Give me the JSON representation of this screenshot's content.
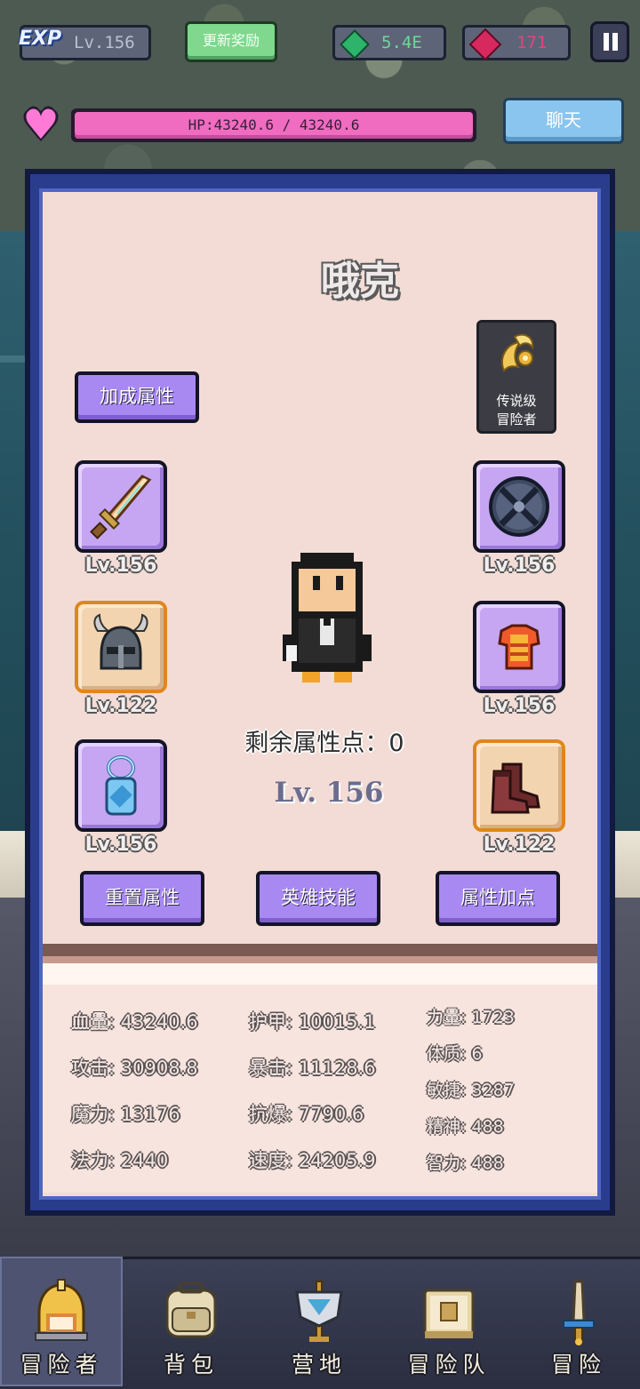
{
  "hud": {
    "exp_logo": "EXP",
    "player_level": "Lv.156",
    "update_reward": "更新奖励",
    "gems": "5.4E",
    "rubies": "171",
    "hp_text": "HP:43240.6 / 43240.6",
    "chat": "聊天"
  },
  "hero": {
    "name": "哦克",
    "rank_badge": [
      "传说级",
      "冒险者"
    ],
    "remaining_points_label": "剩余属性点：0",
    "level": "Lv. 156"
  },
  "buttons": {
    "bonus_attrs": "加成属性",
    "reset_attrs": "重置属性",
    "hero_skills": "英雄技能",
    "add_points": "属性加点"
  },
  "equipment": [
    {
      "slot": "weapon",
      "icon": "sword-icon",
      "level": "Lv.156"
    },
    {
      "slot": "helmet",
      "icon": "horned-helmet-icon",
      "level": "Lv.122"
    },
    {
      "slot": "amulet",
      "icon": "amulet-icon",
      "level": "Lv.156"
    },
    {
      "slot": "shield",
      "icon": "round-shield-icon",
      "level": "Lv.156"
    },
    {
      "slot": "armor",
      "icon": "armor-icon",
      "level": "Lv.156"
    },
    {
      "slot": "boots",
      "icon": "boots-icon",
      "level": "Lv.122"
    }
  ],
  "stats": {
    "col1": [
      "血量: 43240.6",
      "攻击: 30908.8",
      "魔力: 13176",
      "法力: 2440"
    ],
    "col2": [
      "护甲: 10015.1",
      "暴击: 11128.6",
      "抗爆: 7790.6",
      "速度: 24205.9"
    ],
    "col3": [
      "力量: 1723",
      "体质: 6",
      "敏捷: 3287",
      "精神: 488",
      "智力: 488"
    ]
  },
  "nav": [
    {
      "label": "冒险者",
      "icon": "adventurer-helmet-icon",
      "active": true
    },
    {
      "label": "背包",
      "icon": "backpack-icon",
      "active": false
    },
    {
      "label": "营地",
      "icon": "camp-banner-icon",
      "active": false
    },
    {
      "label": "冒险队",
      "icon": "team-book-icon",
      "active": false
    },
    {
      "label": "冒险",
      "icon": "sword-adventure-icon",
      "active": false
    }
  ],
  "colors": {
    "panel_border": "#2a3c8c",
    "panel_bg": "#f3dcd6",
    "button_purple": "#a889f2",
    "hp_pink": "#f06cc0",
    "reward_green": "#7fd88e",
    "chat_blue": "#8ac5ef"
  }
}
